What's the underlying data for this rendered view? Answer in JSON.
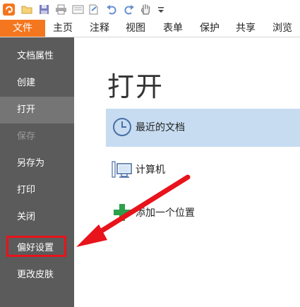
{
  "quick_access": {
    "icons": [
      "app-logo-icon",
      "open-folder-icon",
      "save-icon",
      "print-icon",
      "print-preview-icon",
      "page-icon",
      "undo-icon",
      "redo-icon",
      "hand-tool-icon",
      "customize-dropdown-icon"
    ]
  },
  "ribbon": {
    "file_tab": "文件",
    "tabs": [
      "主页",
      "注释",
      "视图",
      "表单",
      "保护",
      "共享",
      "浏览"
    ]
  },
  "sidebar": {
    "items": [
      {
        "label": "文档属性"
      },
      {
        "label": "创建"
      },
      {
        "label": "打开"
      },
      {
        "label": "保存"
      },
      {
        "label": "另存为"
      },
      {
        "label": "打印"
      },
      {
        "label": "关闭"
      },
      {
        "label": "偏好设置"
      },
      {
        "label": "更改皮肤"
      }
    ]
  },
  "main": {
    "title": "打开",
    "options": [
      {
        "label": "最近的文档",
        "icon": "clock-icon"
      },
      {
        "label": "计算机",
        "icon": "computer-icon"
      },
      {
        "label": "添加一个位置",
        "icon": "plus-icon"
      }
    ]
  },
  "colors": {
    "accent": "#f4761e",
    "sidebar": "#5b5b5b",
    "selected": "#c7dcf1",
    "annotation": "#e8131b"
  }
}
